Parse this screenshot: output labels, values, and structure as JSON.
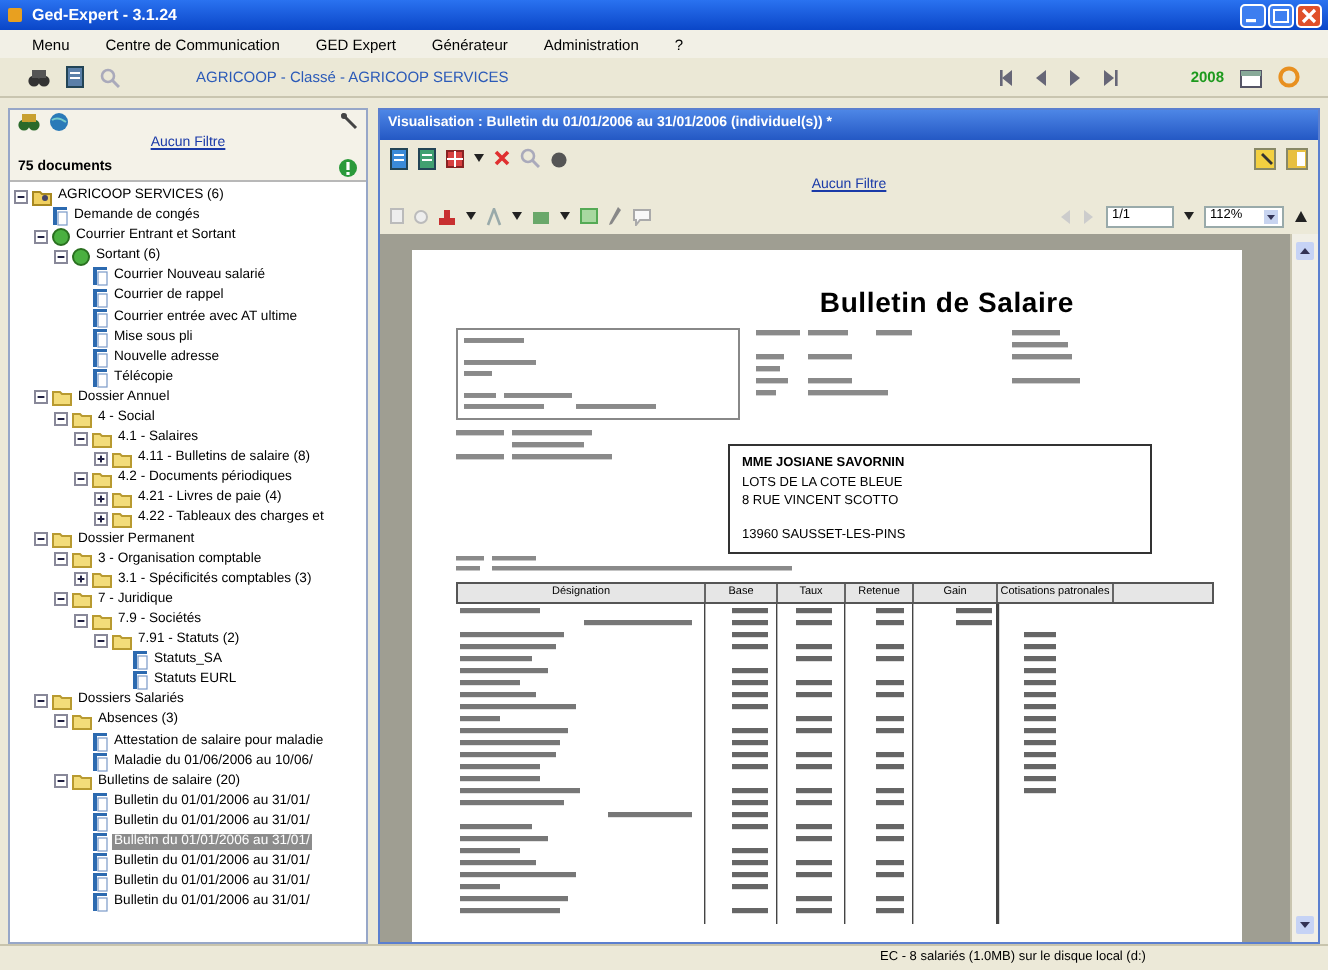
{
  "window": {
    "title": "Ged-Expert - 3.1.24"
  },
  "menu": [
    "Menu",
    "Centre de Communication",
    "GED Expert",
    "Générateur",
    "Administration",
    "?"
  ],
  "toolbar": {
    "path": "AGRICOOP  - Classé - AGRICOOP SERVICES",
    "year": "2008"
  },
  "left_panel": {
    "filter_link": "Aucun Filtre",
    "count": "75 documents",
    "tree": [
      {
        "label": "AGRICOOP SERVICES (6)",
        "kind": "root",
        "expanded": true,
        "selected": false,
        "children": [
          {
            "label": "Demande de congés",
            "kind": "document",
            "selected": false
          },
          {
            "label": "Courrier Entrant et Sortant",
            "kind": "group",
            "expanded": true,
            "selected": false,
            "children": [
              {
                "label": "Sortant (6)",
                "kind": "group",
                "expanded": true,
                "selected": false,
                "children": [
                  {
                    "label": "Courrier Nouveau salarié",
                    "kind": "document",
                    "selected": false
                  },
                  {
                    "label": "Courrier de rappel",
                    "kind": "document",
                    "selected": false
                  },
                  {
                    "label": "Courrier entrée avec AT ultime",
                    "kind": "document",
                    "selected": false
                  },
                  {
                    "label": "Mise sous pli",
                    "kind": "document",
                    "selected": false
                  },
                  {
                    "label": "Nouvelle adresse",
                    "kind": "document",
                    "selected": false
                  },
                  {
                    "label": "Télécopie",
                    "kind": "document",
                    "selected": false
                  }
                ]
              }
            ]
          },
          {
            "label": "Dossier Annuel",
            "kind": "folder",
            "expanded": true,
            "selected": false,
            "children": [
              {
                "label": "4 - Social",
                "kind": "folder",
                "expanded": true,
                "selected": false,
                "children": [
                  {
                    "label": "4.1 - Salaires",
                    "kind": "folder",
                    "expanded": true,
                    "selected": false,
                    "children": [
                      {
                        "label": "4.11 - Bulletins de salaire (8)",
                        "kind": "folder",
                        "expanded": false,
                        "selected": false
                      }
                    ]
                  },
                  {
                    "label": "4.2 - Documents périodiques",
                    "kind": "folder",
                    "expanded": true,
                    "selected": false,
                    "children": [
                      {
                        "label": "4.21 - Livres de paie (4)",
                        "kind": "folder",
                        "expanded": false,
                        "selected": false
                      },
                      {
                        "label": "4.22 - Tableaux des charges et",
                        "kind": "folder",
                        "expanded": false,
                        "selected": false
                      }
                    ]
                  }
                ]
              }
            ]
          },
          {
            "label": "Dossier Permanent",
            "kind": "folder",
            "expanded": true,
            "selected": false,
            "children": [
              {
                "label": "3 - Organisation comptable",
                "kind": "folder",
                "expanded": true,
                "selected": false,
                "children": [
                  {
                    "label": "3.1 - Spécificités comptables (3)",
                    "kind": "folder",
                    "expanded": false,
                    "selected": false
                  }
                ]
              },
              {
                "label": "7 - Juridique",
                "kind": "folder",
                "expanded": true,
                "selected": false,
                "children": [
                  {
                    "label": "7.9 - Sociétés",
                    "kind": "folder",
                    "expanded": true,
                    "selected": false,
                    "children": [
                      {
                        "label": "7.91 - Statuts (2)",
                        "kind": "folder",
                        "expanded": true,
                        "selected": false,
                        "children": [
                          {
                            "label": "Statuts_SA",
                            "kind": "document",
                            "selected": false
                          },
                          {
                            "label": "Statuts EURL",
                            "kind": "document",
                            "selected": false
                          }
                        ]
                      }
                    ]
                  }
                ]
              }
            ]
          },
          {
            "label": "Dossiers Salariés",
            "kind": "folder",
            "expanded": true,
            "selected": false,
            "children": [
              {
                "label": "Absences (3)",
                "kind": "folder",
                "expanded": true,
                "selected": false,
                "children": [
                  {
                    "label": "Attestation de salaire pour maladie",
                    "kind": "document",
                    "selected": false
                  },
                  {
                    "label": "Maladie du 01/06/2006 au 10/06/",
                    "kind": "document",
                    "selected": false
                  }
                ]
              },
              {
                "label": "Bulletins de salaire (20)",
                "kind": "folder",
                "expanded": true,
                "selected": false,
                "children": [
                  {
                    "label": "Bulletin du 01/01/2006 au 31/01/",
                    "kind": "document",
                    "selected": false
                  },
                  {
                    "label": "Bulletin du 01/01/2006 au 31/01/",
                    "kind": "document",
                    "selected": false
                  },
                  {
                    "label": "Bulletin du 01/01/2006 au 31/01/",
                    "kind": "document",
                    "selected": true
                  },
                  {
                    "label": "Bulletin du 01/01/2006 au 31/01/",
                    "kind": "document",
                    "selected": false
                  },
                  {
                    "label": "Bulletin du 01/01/2006 au 31/01/",
                    "kind": "document",
                    "selected": false
                  },
                  {
                    "label": "Bulletin du 01/01/2006 au 31/01/",
                    "kind": "document",
                    "selected": false
                  }
                ]
              }
            ]
          }
        ]
      }
    ]
  },
  "viewer": {
    "title": "Visualisation : Bulletin du 01/01/2006 au 31/01/2006 (individuel(s)) *",
    "filter_link": "Aucun Filtre",
    "page": "1/1",
    "zoom": "112%",
    "document": {
      "title": "Bulletin de Salaire",
      "recipient": [
        "MME JOSIANE SAVORNIN",
        "LOTS DE LA COTE BLEUE",
        "8 RUE VINCENT SCOTTO",
        "13960  SAUSSET-LES-PINS"
      ],
      "table_headers": [
        "Désignation",
        "Base",
        "Taux",
        "Retenue",
        "Gain",
        "Cotisations patronales"
      ]
    }
  },
  "status_bar": "EC - 8 salariés (1.0MB) sur le disque local (d:)"
}
